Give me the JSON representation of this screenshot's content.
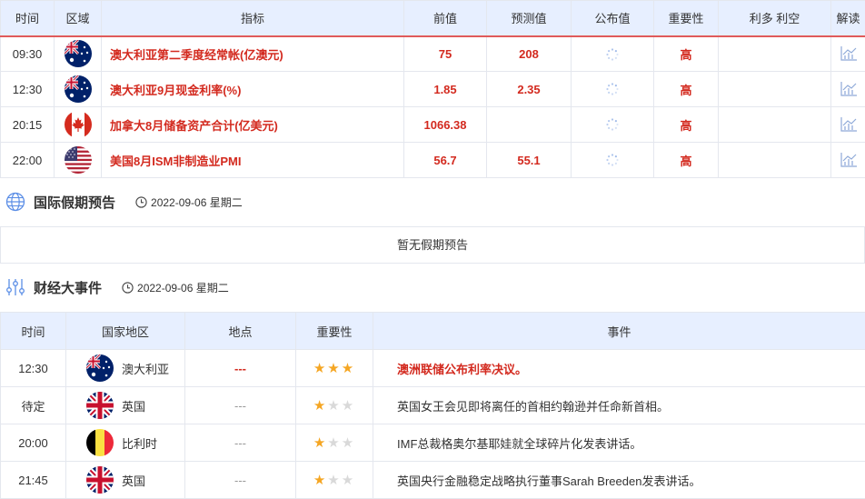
{
  "calendar": {
    "headers": [
      "时间",
      "区域",
      "指标",
      "前值",
      "预测值",
      "公布值",
      "重要性",
      "利多 利空",
      "解读"
    ],
    "rows": [
      {
        "time": "09:30",
        "flag": "au-flag-icon",
        "indicator": "澳大利亚第二季度经常帐(亿澳元)",
        "prev": "75",
        "forecast": "208",
        "importance": "高"
      },
      {
        "time": "12:30",
        "flag": "au-flag-icon",
        "indicator": "澳大利亚9月现金利率(%)",
        "prev": "1.85",
        "forecast": "2.35",
        "importance": "高"
      },
      {
        "time": "20:15",
        "flag": "ca-flag-icon",
        "indicator": "加拿大8月储备资产合计(亿美元)",
        "prev": "1066.38",
        "forecast": "",
        "importance": "高"
      },
      {
        "time": "22:00",
        "flag": "us-flag-icon",
        "indicator": "美国8月ISM非制造业PMI",
        "prev": "56.7",
        "forecast": "55.1",
        "importance": "高"
      }
    ]
  },
  "holiday": {
    "title": "国际假期预告",
    "date": "2022-09-06 星期二",
    "empty_text": "暂无假期预告",
    "icon": "globe-icon"
  },
  "events": {
    "title": "财经大事件",
    "date": "2022-09-06 星期二",
    "icon": "sliders-icon",
    "headers": [
      "时间",
      "国家地区",
      "地点",
      "重要性",
      "事件"
    ],
    "rows": [
      {
        "time": "12:30",
        "country": "澳大利亚",
        "flag": "au-flag-icon",
        "place": "---",
        "stars": 3,
        "event": "澳洲联储公布利率决议。",
        "highlight": true
      },
      {
        "time": "待定",
        "country": "英国",
        "flag": "uk-flag-icon",
        "place": "---",
        "stars": 1,
        "event": "英国女王会见即将离任的首相约翰逊并任命新首相。",
        "highlight": false
      },
      {
        "time": "20:00",
        "country": "比利时",
        "flag": "be-flag-icon",
        "place": "---",
        "stars": 1,
        "event": "IMF总裁格奥尔基耶娃就全球碎片化发表讲话。",
        "highlight": false
      },
      {
        "time": "21:45",
        "country": "英国",
        "flag": "uk-flag-icon",
        "place": "---",
        "stars": 1,
        "event": "英国央行金融稳定战略执行董事Sarah Breeden发表讲话。",
        "highlight": false
      }
    ]
  },
  "colors": {
    "accent_red": "#d32a1f",
    "header_bg": "#e7efff",
    "star": "#f5a623"
  }
}
